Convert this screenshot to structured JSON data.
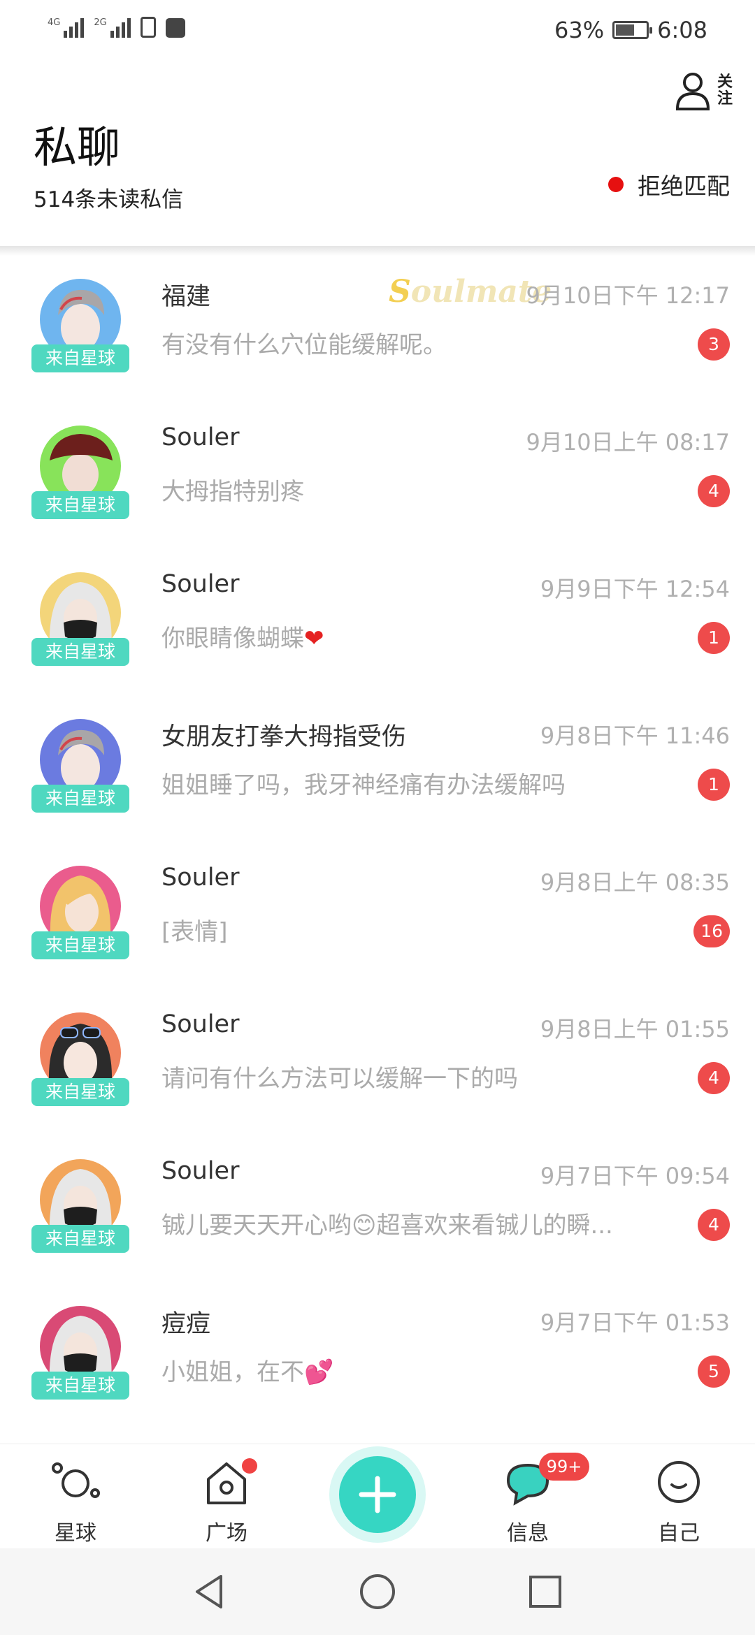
{
  "status_bar": {
    "signal1_label": "4G",
    "signal2_label": "2G",
    "battery_percent": "63%",
    "battery_level": 0.63,
    "time": "6:08"
  },
  "header": {
    "title": "私聊",
    "unread_summary": "514条未读私信",
    "follow_label": "关注",
    "reject_match_label": "拒绝匹配",
    "reject_dot_color": "#e61010"
  },
  "watermark": {
    "first_letter": "S",
    "rest": "oulmate"
  },
  "conversations": [
    {
      "name": "福建",
      "time": "9月10日下午 12:17",
      "message": "有没有什么穴位能缓解呢。",
      "unread": "3",
      "origin": "来自星球",
      "avatar": "avatar-man-gray-hair-icon"
    },
    {
      "name": "Souler",
      "time": "9月10日上午 08:17",
      "message": "大拇指特别疼",
      "unread": "4",
      "origin": "来自星球",
      "avatar": "avatar-red-bucket-hat-icon"
    },
    {
      "name": "Souler",
      "time": "9月9日下午 12:54",
      "message": "你眼睛像蝴蝶",
      "message_emoji": "❤",
      "unread": "1",
      "origin": "来自星球",
      "avatar": "avatar-white-hood-mask-icon"
    },
    {
      "name": "女朋友打拳大拇指受伤",
      "time": "9月8日下午 11:46",
      "message": "姐姐睡了吗，我牙神经痛有办法缓解吗",
      "unread": "1",
      "origin": "来自星球",
      "avatar": "avatar-man-gray-hair-icon"
    },
    {
      "name": "Souler",
      "time": "9月8日上午 08:35",
      "message": "[表情]",
      "unread": "16",
      "origin": "来自星球",
      "avatar": "avatar-blonde-hair-icon"
    },
    {
      "name": "Souler",
      "time": "9月8日上午 01:55",
      "message": "请问有什么方法可以缓解一下的吗",
      "unread": "4",
      "origin": "来自星球",
      "avatar": "avatar-girl-sunglasses-icon"
    },
    {
      "name": "Souler",
      "time": "9月7日下午 09:54",
      "message": "铖儿要天天开心哟😊超喜欢来看铖儿的瞬...",
      "unread": "4",
      "origin": "来自星球",
      "avatar": "avatar-white-hood-mask-icon"
    },
    {
      "name": "痘痘",
      "time": "9月7日下午 01:53",
      "message": "小姐姐，在不",
      "message_emoji": "💕",
      "unread": "5",
      "origin": "来自星球",
      "avatar": "avatar-white-hood-mask-icon"
    }
  ],
  "tab_bar": {
    "tabs": [
      {
        "label": "星球",
        "icon": "planet-icon"
      },
      {
        "label": "广场",
        "icon": "square-house-icon"
      },
      {
        "label": "信息",
        "icon": "message-icon",
        "badge": "99+"
      },
      {
        "label": "自己",
        "icon": "smile-face-icon"
      }
    ],
    "add_button_icon": "plus-icon",
    "accent_color": "#36d6c3"
  },
  "nav_bar": {
    "buttons": [
      "back-icon",
      "home-icon",
      "recents-icon"
    ]
  }
}
